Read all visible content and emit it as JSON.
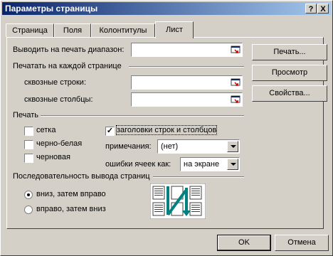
{
  "window": {
    "title": "Параметры страницы",
    "help_label": "?",
    "close_label": "X"
  },
  "tabs": [
    {
      "label": "Страница",
      "active": false
    },
    {
      "label": "Поля",
      "active": false
    },
    {
      "label": "Колонтитулы",
      "active": false
    },
    {
      "label": "Лист",
      "active": true
    }
  ],
  "print_area": {
    "label": "Выводить на печать диапазон:",
    "value": ""
  },
  "print_titles": {
    "group_label": "Печатать на каждой странице",
    "rows_label": "сквозные строки:",
    "rows_value": "",
    "cols_label": "сквозные столбцы:",
    "cols_value": ""
  },
  "print": {
    "group_label": "Печать",
    "gridlines": {
      "label": "сетка",
      "checked": false
    },
    "black_white": {
      "label": "черно-белая",
      "checked": false
    },
    "draft": {
      "label": "черновая",
      "checked": false
    },
    "headings": {
      "label": "заголовки строк и столбцов",
      "checked": true
    },
    "comments": {
      "label": "примечания:",
      "value": "(нет)"
    },
    "cell_errors": {
      "label": "ошибки ячеек как:",
      "value": "на экране"
    }
  },
  "page_order": {
    "group_label": "Последовательность вывода страниц",
    "down_then_over": {
      "label": "вниз, затем вправо",
      "selected": true
    },
    "over_then_down": {
      "label": "вправо, затем вниз",
      "selected": false
    }
  },
  "buttons": {
    "print": "Печать...",
    "preview": "Просмотр",
    "properties": "Свойства...",
    "ok": "OK",
    "cancel": "Отмена"
  },
  "colors": {
    "title_gradient_start": "#0a246a",
    "title_gradient_end": "#a6caf0",
    "face": "#d4d0c8",
    "order_arrow": "#008080"
  }
}
